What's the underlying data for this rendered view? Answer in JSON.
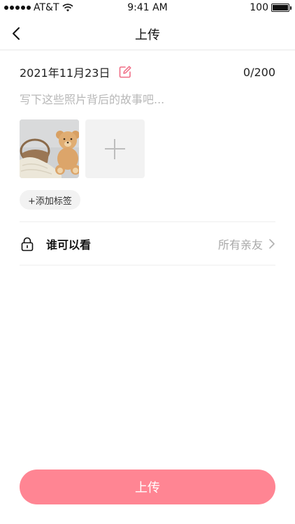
{
  "status_bar": {
    "carrier": "AT&T",
    "time": "9:41 AM",
    "battery": "100"
  },
  "nav": {
    "title": "上传"
  },
  "post": {
    "date": "2021年11月23日",
    "char_count": "0/200",
    "description_placeholder": "写下这些照片背后的故事吧...",
    "description_value": "",
    "add_tag_label": "+添加标签"
  },
  "privacy": {
    "label": "谁可以看",
    "value": "所有亲友"
  },
  "actions": {
    "upload_label": "上传"
  },
  "colors": {
    "accent": "#ff8593",
    "edit_icon": "#f06d85"
  }
}
